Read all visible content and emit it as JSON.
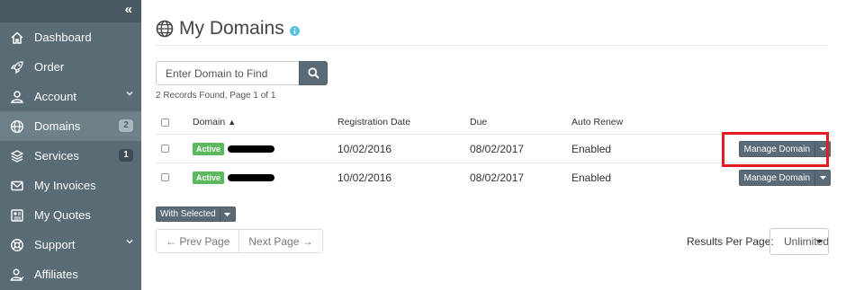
{
  "sidebar": {
    "collapse_icon": "double-chevron-left-icon",
    "items": [
      {
        "label": "Dashboard",
        "icon": "home-icon"
      },
      {
        "label": "Order",
        "icon": "rocket-icon"
      },
      {
        "label": "Account",
        "icon": "user-icon",
        "has_submenu": true
      },
      {
        "label": "Domains",
        "icon": "globe-icon",
        "badge": "2",
        "active": true
      },
      {
        "label": "Services",
        "icon": "layers-icon",
        "badge": "1"
      },
      {
        "label": "My Invoices",
        "icon": "envelope-icon"
      },
      {
        "label": "My Quotes",
        "icon": "quote-icon"
      },
      {
        "label": "Support",
        "icon": "lifebuoy-icon",
        "has_submenu": true
      },
      {
        "label": "Affiliates",
        "icon": "users-icon"
      }
    ]
  },
  "header": {
    "title": "My Domains",
    "title_icon": "globe-icon",
    "info_icon": "info-icon"
  },
  "search": {
    "placeholder": "Enter Domain to Find",
    "button_icon": "search-icon"
  },
  "records_info": "2 Records Found, Page 1 of 1",
  "table": {
    "columns": [
      "Domain",
      "Registration Date",
      "Due",
      "Auto Renew"
    ],
    "sort_column": "Domain",
    "rows": [
      {
        "status": "Active",
        "registration_date": "10/02/2016",
        "due": "08/02/2017",
        "auto_renew": "Enabled",
        "action": "Manage Domain",
        "highlighted": true
      },
      {
        "status": "Active",
        "registration_date": "10/02/2016",
        "due": "08/02/2017",
        "auto_renew": "Enabled",
        "action": "Manage Domain"
      }
    ]
  },
  "bulk_action": {
    "label": "With Selected"
  },
  "pagination": {
    "prev": "← Prev Page",
    "next": "Next Page →"
  },
  "results_per_page": {
    "label": "Results Per Page:",
    "value": "Unlimited"
  },
  "colors": {
    "sidebar_bg": "#596b74",
    "sidebar_active": "#6e8189",
    "button_bg": "#5a6b77",
    "active_badge": "#5cb85c",
    "highlight": "#e41b23"
  }
}
